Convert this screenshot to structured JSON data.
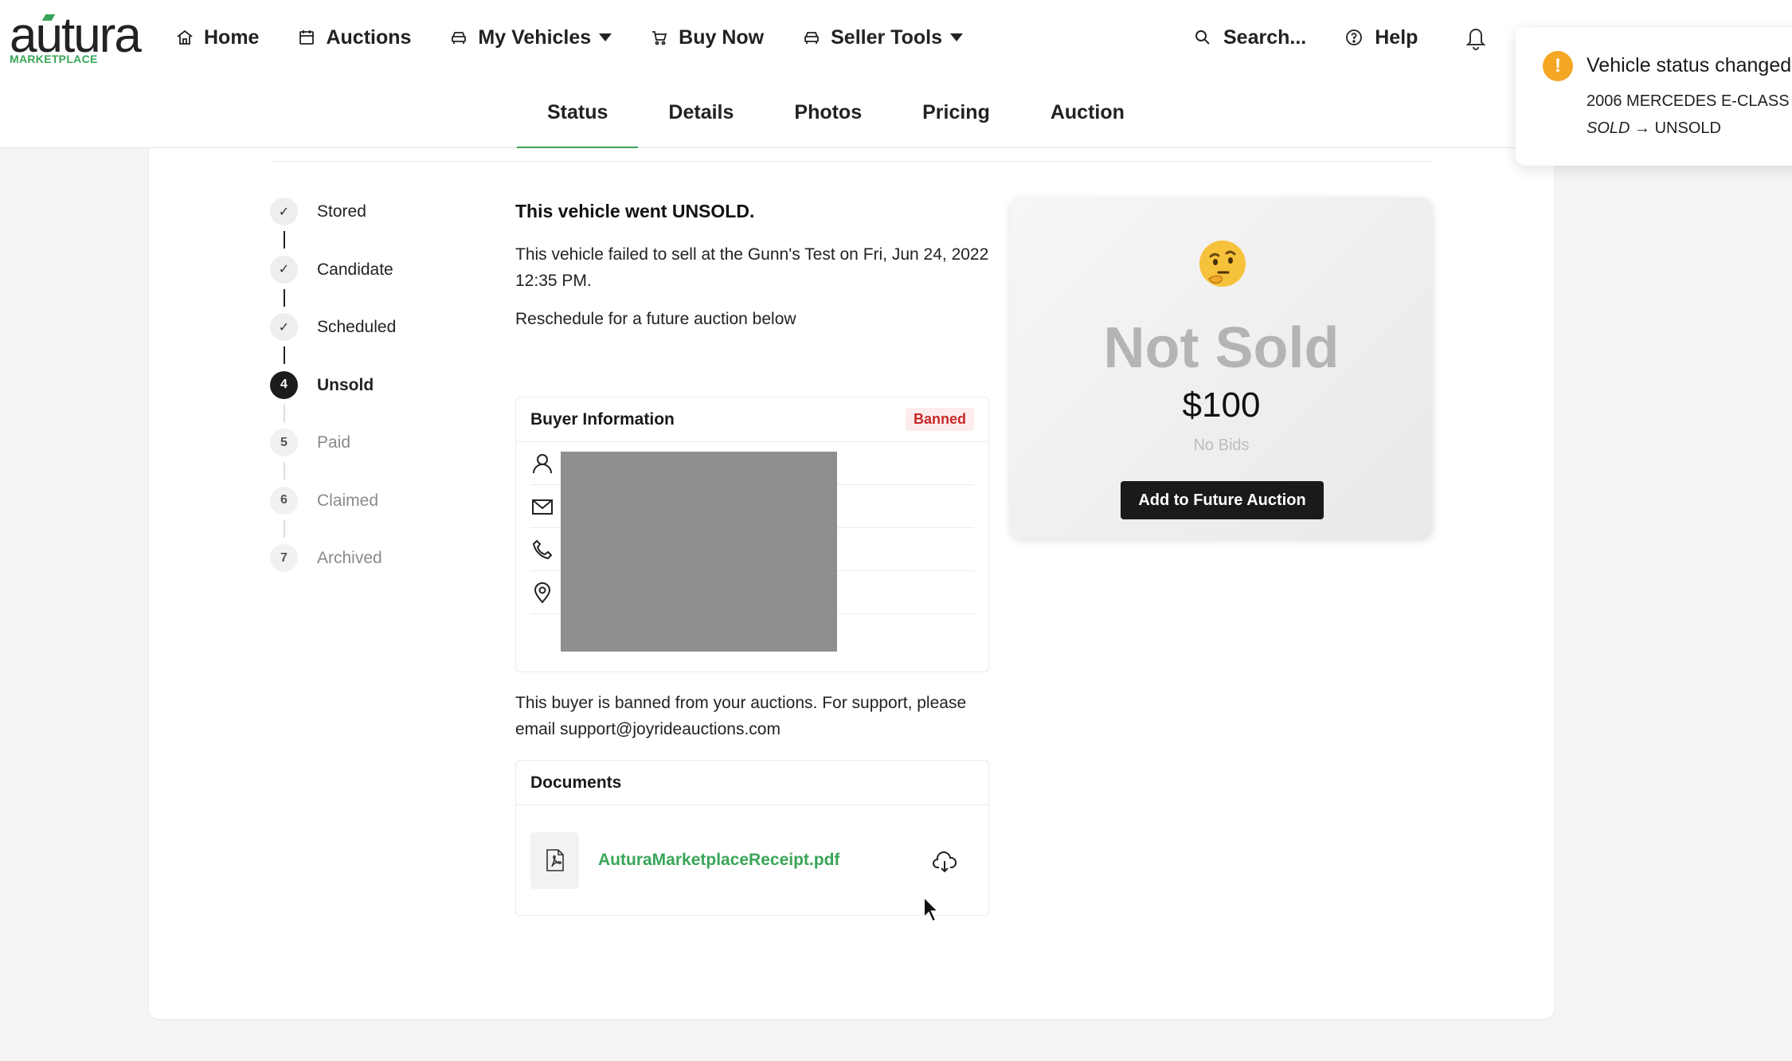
{
  "brand": {
    "name": "autura",
    "sub": "MARKETPLACE",
    "accent": "#3aa558"
  },
  "nav": {
    "home": "Home",
    "auctions": "Auctions",
    "my_vehicles": "My Vehicles",
    "buy_now": "Buy Now",
    "seller_tools": "Seller Tools",
    "search": "Search...",
    "help": "Help"
  },
  "tabs": [
    "Status",
    "Details",
    "Photos",
    "Pricing",
    "Auction"
  ],
  "active_tab": "Status",
  "stepper": [
    {
      "num": "✓",
      "label": "Stored",
      "state": "done"
    },
    {
      "num": "✓",
      "label": "Candidate",
      "state": "done"
    },
    {
      "num": "✓",
      "label": "Scheduled",
      "state": "done"
    },
    {
      "num": "4",
      "label": "Unsold",
      "state": "current"
    },
    {
      "num": "5",
      "label": "Paid",
      "state": "future"
    },
    {
      "num": "6",
      "label": "Claimed",
      "state": "future"
    },
    {
      "num": "7",
      "label": "Archived",
      "state": "future"
    }
  ],
  "status": {
    "title": "This vehicle went UNSOLD.",
    "text": "This vehicle failed to sell at the Gunn's Test on Fri, Jun 24, 2022 12:35 PM.",
    "reschedule": "Reschedule for a future auction below"
  },
  "buyer": {
    "title": "Buyer Information",
    "badge": "Banned",
    "banned_note": "This buyer is banned from your auctions. For support, please email support@joyrideauctions.com"
  },
  "documents": {
    "title": "Documents",
    "file": "AuturaMarketplaceReceipt.pdf"
  },
  "summary": {
    "status": "Not Sold",
    "price": "$100",
    "bids": "No Bids",
    "button": "Add to Future Auction"
  },
  "toast": {
    "icon": "!",
    "title": "Vehicle status changed",
    "vehicle": "2006 MERCEDES E-CLASS",
    "from": "SOLD",
    "arrow": "→",
    "to": "UNSOLD"
  },
  "colors": {
    "accent": "#3aa558",
    "banned": "#c62828",
    "warning": "#f5a623"
  }
}
